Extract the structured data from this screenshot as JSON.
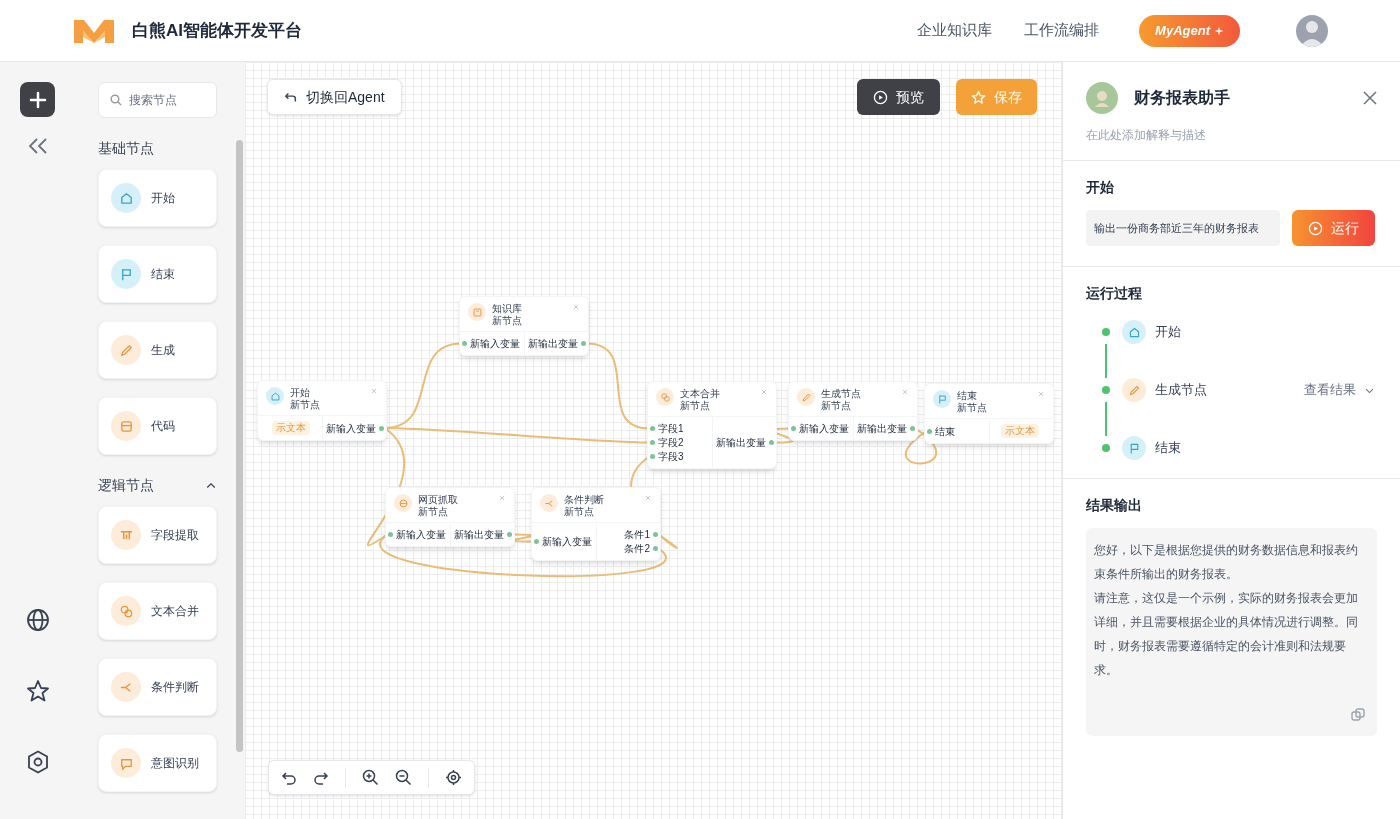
{
  "header": {
    "title": "白熊AI智能体开发平台",
    "nav": [
      {
        "label": "企业知识库"
      },
      {
        "label": "工作流编排"
      }
    ],
    "agent_button": "MyAgent"
  },
  "palette": {
    "search_placeholder": "搜索节点",
    "sections": [
      {
        "kind": "static",
        "title": "基础节点",
        "items": [
          {
            "kind": "start",
            "label": "开始"
          },
          {
            "kind": "end",
            "label": "结束"
          },
          {
            "kind": "generate",
            "label": "生成"
          },
          {
            "kind": "code",
            "label": "代码"
          }
        ]
      },
      {
        "kind": "collapsible",
        "title": "逻辑节点",
        "expanded": true,
        "items": [
          {
            "kind": "extract",
            "label": "字段提取"
          },
          {
            "kind": "merge",
            "label": "文本合并"
          },
          {
            "kind": "condition",
            "label": "条件判断"
          },
          {
            "kind": "intent",
            "label": "意图识别"
          }
        ]
      }
    ]
  },
  "canvas": {
    "switch_button": "切换回Agent",
    "preview_button": "预览",
    "save_button": "保存",
    "nodes": [
      {
        "kind": "start",
        "title": "开始",
        "subtitle": "新节点",
        "left": [
          {
            "kind": "tag",
            "label": "示文本"
          }
        ],
        "right": [
          {
            "kind": "port",
            "label": "新输入变量"
          }
        ]
      },
      {
        "kind": "knowledge",
        "title": "知识库",
        "subtitle": "新节点",
        "left": [
          {
            "kind": "port",
            "label": "新输入变量"
          }
        ],
        "right": [
          {
            "kind": "port",
            "label": "新输出变量"
          }
        ]
      },
      {
        "kind": "merge",
        "title": "文本合并",
        "subtitle": "新节点",
        "left": [
          {
            "kind": "port",
            "label": "字段1"
          },
          {
            "kind": "port",
            "label": "字段2"
          },
          {
            "kind": "port",
            "label": "字段3"
          }
        ],
        "right": [
          {
            "kind": "port",
            "label": "新输出变量"
          }
        ]
      },
      {
        "kind": "generate",
        "title": "生成节点",
        "subtitle": "新节点",
        "left": [
          {
            "kind": "port",
            "label": "新输入变量"
          }
        ],
        "right": [
          {
            "kind": "port",
            "label": "新输出变量"
          }
        ]
      },
      {
        "kind": "end",
        "title": "结束",
        "subtitle": "新节点",
        "left": [
          {
            "kind": "port",
            "label": "结束"
          }
        ],
        "right": [
          {
            "kind": "tag",
            "label": "示文本"
          }
        ]
      },
      {
        "kind": "web",
        "title": "网页抓取",
        "subtitle": "新节点",
        "left": [
          {
            "kind": "port",
            "label": "新输入变量"
          }
        ],
        "right": [
          {
            "kind": "port",
            "label": "新输出变量"
          }
        ]
      },
      {
        "kind": "condition",
        "title": "条件判断",
        "subtitle": "新节点",
        "left": [
          {
            "kind": "port",
            "label": "新输入变量"
          }
        ],
        "right": [
          {
            "kind": "port",
            "label": "条件1"
          },
          {
            "kind": "port",
            "label": "条件2"
          }
        ]
      }
    ]
  },
  "panel": {
    "agent_name": "财务报表助手",
    "description_placeholder": "在此处添加解释与描述",
    "start_title": "开始",
    "start_input": "输出一份商务部近三年的财务报表",
    "run_button": "运行",
    "process_title": "运行过程",
    "steps": [
      {
        "kind": "start",
        "label": "开始"
      },
      {
        "kind": "generate",
        "label": "生成节点",
        "action": "查看结果"
      },
      {
        "kind": "end",
        "label": "结束"
      }
    ],
    "result_title": "结果输出",
    "result_paragraphs": [
      "您好，以下是根据您提供的财务数据信息和报表约束条件所输出的财务报表。",
      "请注意，这仅是一个示例，实际的财务报表会更加详细，并且需要根据企业的具体情况进行调整。同时，财务报表需要遵循特定的会计准则和法规要求。"
    ]
  }
}
